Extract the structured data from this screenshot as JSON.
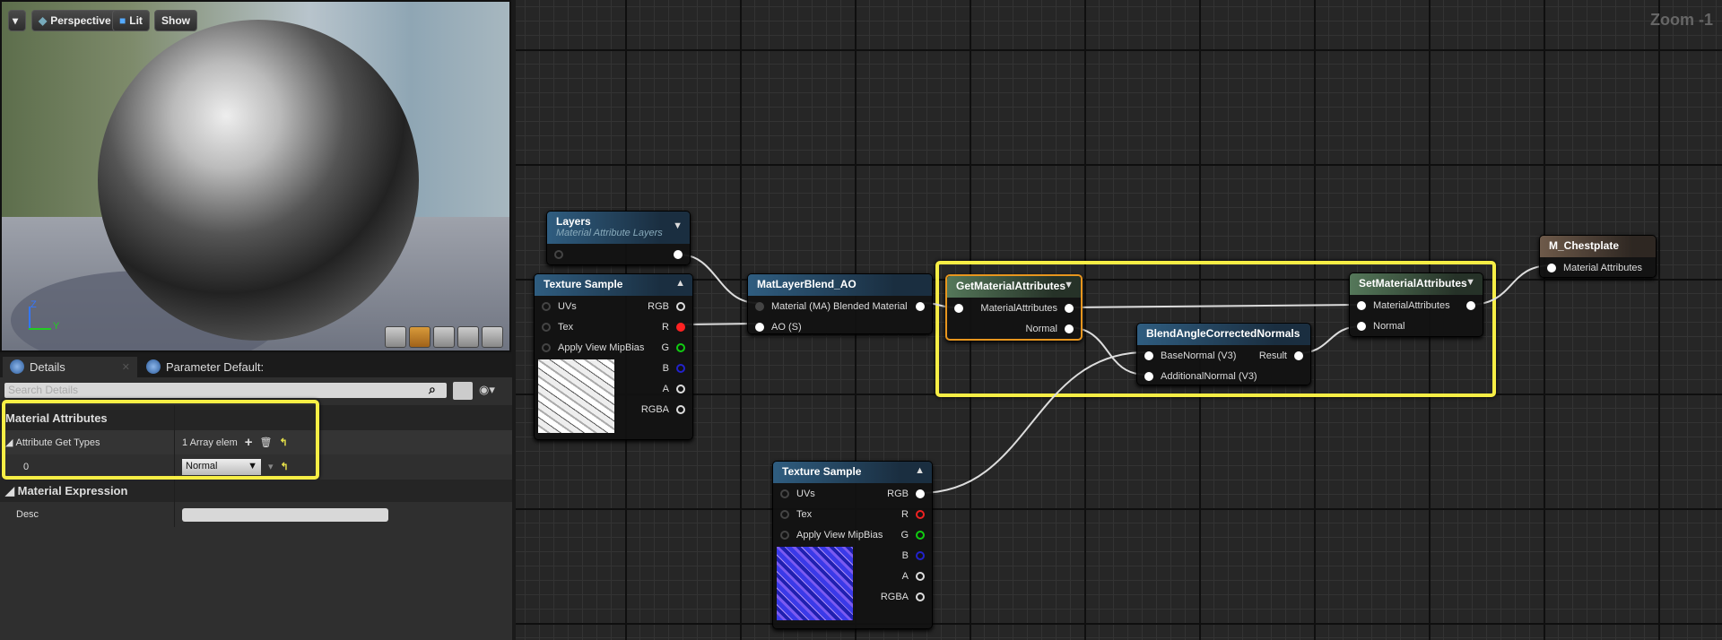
{
  "viewport": {
    "menu_icon": "chevron-down-icon",
    "perspective": "Perspective",
    "lit": "Lit",
    "show": "Show",
    "axis_z": "Z",
    "axis_y": "Y",
    "preview_shapes": [
      "cylinder",
      "sphere",
      "plane",
      "cube",
      "custom-mesh"
    ],
    "active_shape": "sphere"
  },
  "details": {
    "tabs": [
      {
        "label": "Details"
      },
      {
        "label": "Parameter Default:"
      }
    ],
    "search_placeholder": "Search Details",
    "sections": {
      "material_attributes": "Material Attributes",
      "attribute_get_types": "Attribute Get Types",
      "array_summary": "1 Array elem",
      "index": "0",
      "selected_type": "Normal",
      "material_expression": "Material Expression",
      "desc": "Desc"
    }
  },
  "graph": {
    "zoom": "Zoom -1",
    "layers": {
      "title": "Layers",
      "subtitle": "Material Attribute Layers"
    },
    "tex1": {
      "title": "Texture Sample",
      "inputs": [
        "UVs",
        "Tex",
        "Apply View MipBias"
      ],
      "outputs": [
        "RGB",
        "R",
        "G",
        "B",
        "A",
        "RGBA"
      ]
    },
    "blend_ao": {
      "title": "MatLayerBlend_AO",
      "in1": "Material (MA) Blended Material",
      "in2": "AO (S)"
    },
    "get_ma": {
      "title": "GetMaterialAttributes",
      "p1": "MaterialAttributes",
      "p2": "Normal"
    },
    "blend_normals": {
      "title": "BlendAngleCorrectedNormals",
      "in1": "BaseNormal (V3)",
      "in2": "AdditionalNormal (V3)",
      "out": "Result"
    },
    "set_ma": {
      "title": "SetMaterialAttributes",
      "p1": "MaterialAttributes",
      "p2": "Normal"
    },
    "output": {
      "title": "M_Chestplate",
      "in": "Material Attributes"
    },
    "tex2": {
      "title": "Texture Sample",
      "inputs": [
        "UVs",
        "Tex",
        "Apply View MipBias"
      ],
      "outputs": [
        "RGB",
        "R",
        "G",
        "B",
        "A",
        "RGBA"
      ]
    }
  },
  "colors": {
    "highlight": "#f7ee45",
    "selected_node": "#e8961e",
    "grid": "#262626"
  }
}
